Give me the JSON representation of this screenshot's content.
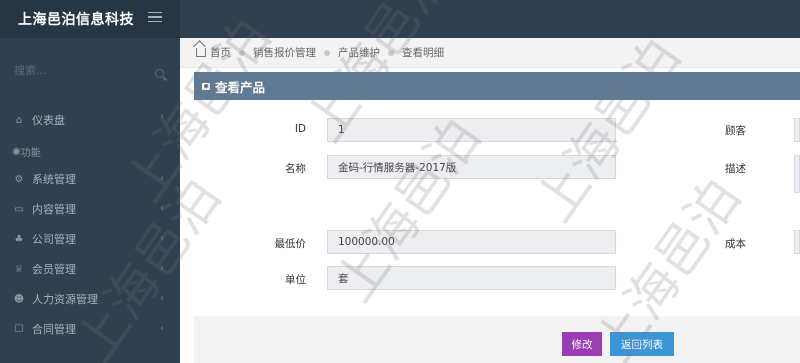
{
  "brand": {
    "title": "上海邑泊信息科技"
  },
  "sidebar": {
    "search_placeholder": "搜索...",
    "items": [
      {
        "label": "仪表盘",
        "icon": "home-icon"
      },
      {
        "label": "系统管理",
        "icon": "gears-icon"
      },
      {
        "label": "内容管理",
        "icon": "keyboard-icon"
      },
      {
        "label": "公司管理",
        "icon": "sitemap-icon"
      },
      {
        "label": "会员管理",
        "icon": "trophy-icon"
      },
      {
        "label": "人力资源管理",
        "icon": "users-icon"
      },
      {
        "label": "合同管理",
        "icon": "document-icon"
      }
    ],
    "section_label": "功能"
  },
  "breadcrumb": [
    "首页",
    "销售报价管理",
    "产品维护",
    "查看明细"
  ],
  "panel": {
    "title": "查看产品",
    "fields": {
      "id": {
        "label": "ID",
        "value": "1"
      },
      "name": {
        "label": "名称",
        "value": "金码-行情服务器-2017版"
      },
      "min_price": {
        "label": "最低价",
        "value": "100000.00"
      },
      "unit": {
        "label": "单位",
        "value": "套"
      },
      "customer": {
        "label": "顾客"
      },
      "description": {
        "label": "描述"
      },
      "cost": {
        "label": "成本"
      }
    },
    "buttons": {
      "edit": "修改",
      "back": "返回列表"
    }
  },
  "watermark_text": "上海邑泊"
}
